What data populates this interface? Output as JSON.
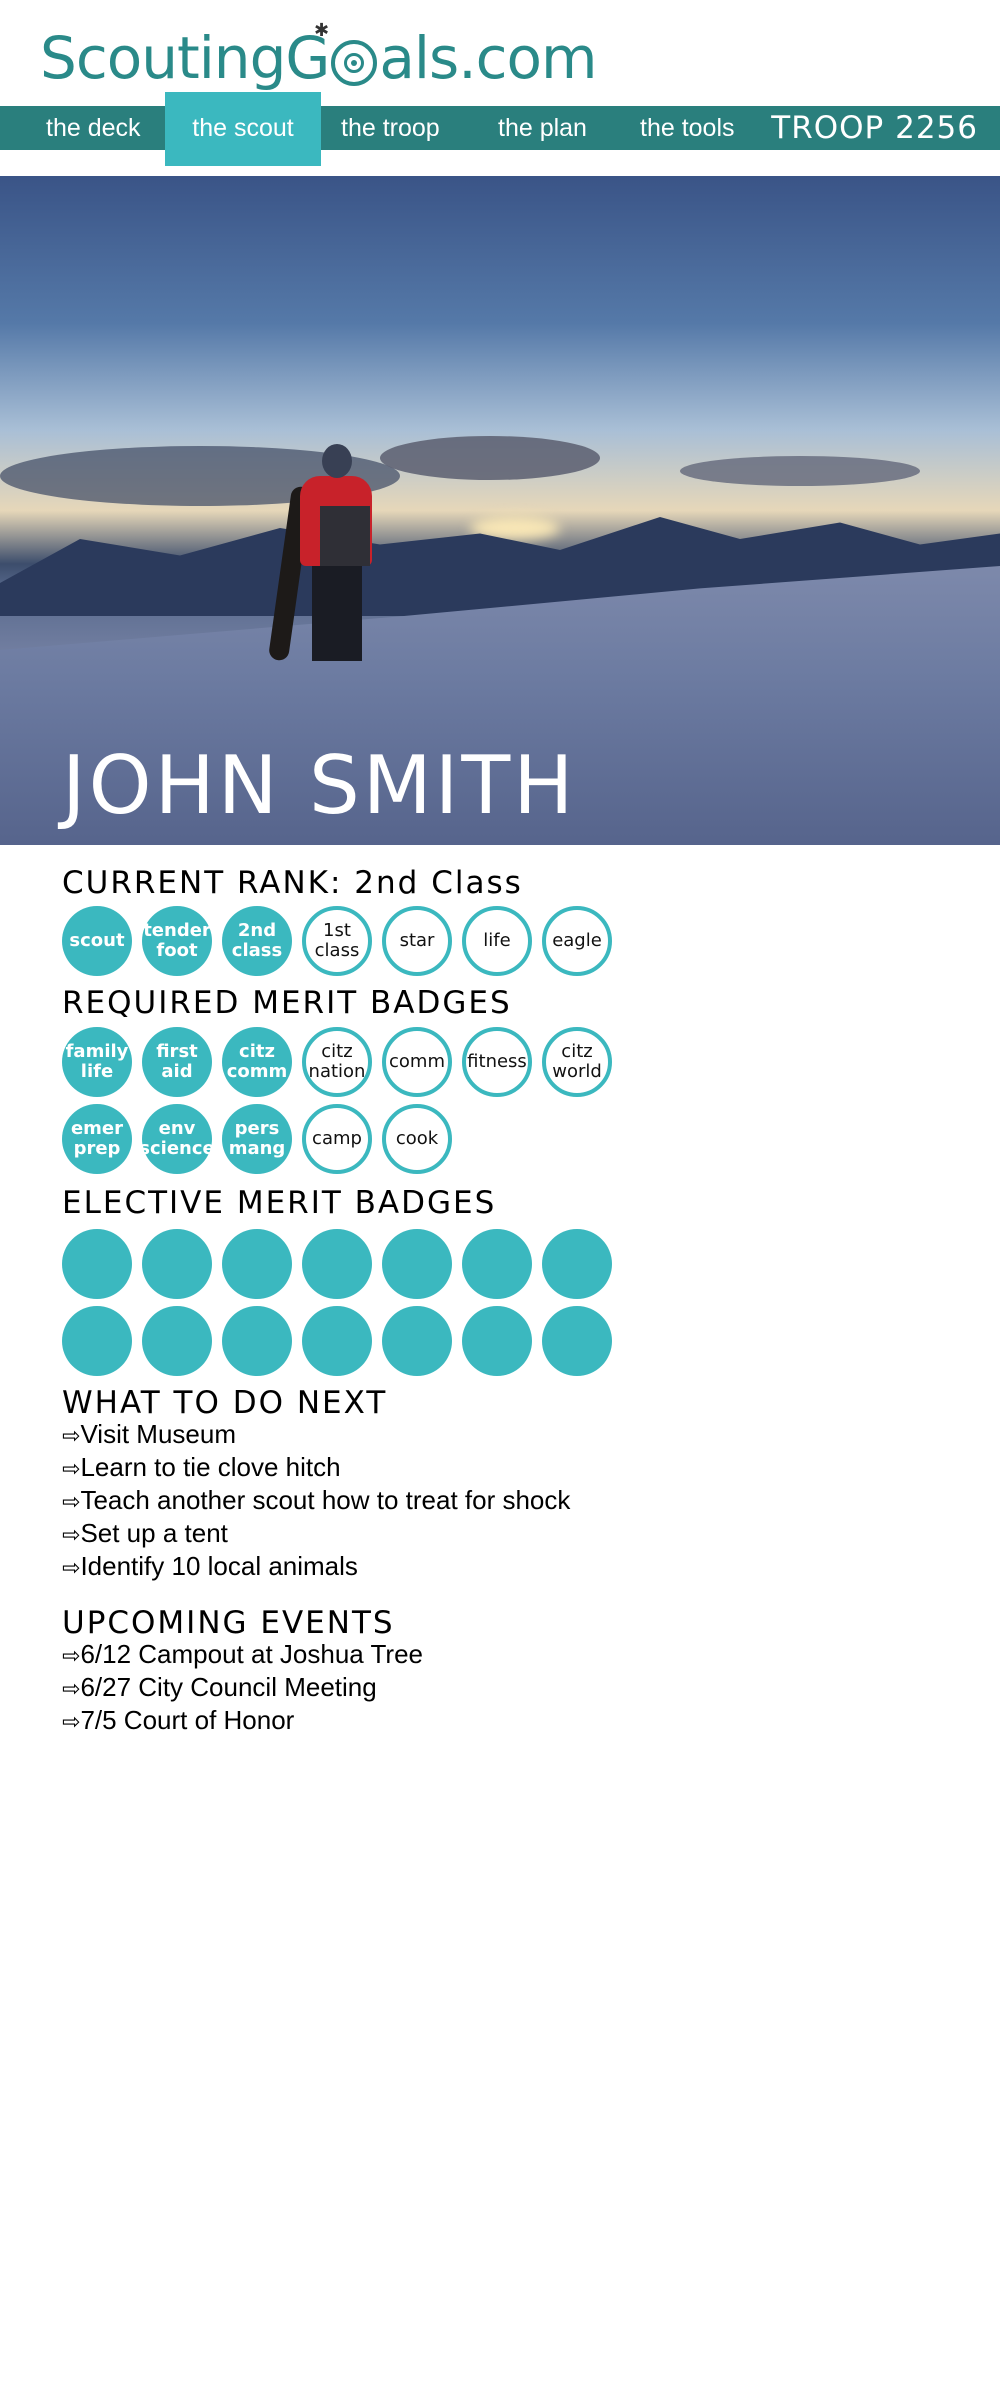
{
  "logo": {
    "text_before": "ScoutingG",
    "text_after": "als.com",
    "flag_icon": "✱"
  },
  "nav": {
    "items": [
      {
        "label": "the deck"
      },
      {
        "label": "the scout",
        "active": true
      },
      {
        "label": "the troop"
      },
      {
        "label": "the plan"
      },
      {
        "label": "the tools"
      }
    ],
    "troop": "TROOP 2256"
  },
  "hero": {
    "name": "JOHN SMITH"
  },
  "rank": {
    "title": "CURRENT RANK: 2nd Class",
    "badges": [
      {
        "label": "scout",
        "earned": true
      },
      {
        "label": "tender\nfoot",
        "earned": true
      },
      {
        "label": "2nd\nclass",
        "earned": true
      },
      {
        "label": "1st\nclass",
        "earned": false
      },
      {
        "label": "star",
        "earned": false
      },
      {
        "label": "life",
        "earned": false
      },
      {
        "label": "eagle",
        "earned": false
      }
    ]
  },
  "required": {
    "title": "REQUIRED MERIT BADGES",
    "row1": [
      {
        "label": "family\nlife",
        "earned": true
      },
      {
        "label": "first\naid",
        "earned": true
      },
      {
        "label": "citz\ncomm",
        "earned": true
      },
      {
        "label": "citz\nnation",
        "earned": false
      },
      {
        "label": "comm",
        "earned": false
      },
      {
        "label": "fitness",
        "earned": false
      },
      {
        "label": "citz\nworld",
        "earned": false
      }
    ],
    "row2": [
      {
        "label": "emer\nprep",
        "earned": true
      },
      {
        "label": "env\nscience",
        "earned": true
      },
      {
        "label": "pers\nmang",
        "earned": true
      },
      {
        "label": "camp",
        "earned": false
      },
      {
        "label": "cook",
        "earned": false
      }
    ]
  },
  "elective": {
    "title": "ELECTIVE MERIT BADGES",
    "slots_per_row": 7,
    "rows": 2
  },
  "next": {
    "title": "WHAT TO DO NEXT",
    "arrow": "⇨",
    "items": [
      "Visit Museum",
      "Learn to tie clove hitch",
      "Teach another scout how to treat for shock",
      "Set up a tent",
      "Identify 10 local animals"
    ]
  },
  "events": {
    "title": "UPCOMING EVENTS",
    "arrow": "⇨",
    "items": [
      "6/12 Campout at Joshua Tree",
      "6/27 City Council Meeting",
      "7/5 Court of Honor"
    ]
  },
  "colors": {
    "teal_dark": "#2a7f7d",
    "teal_light": "#3bb8bf",
    "logo": "#2a8a89"
  }
}
